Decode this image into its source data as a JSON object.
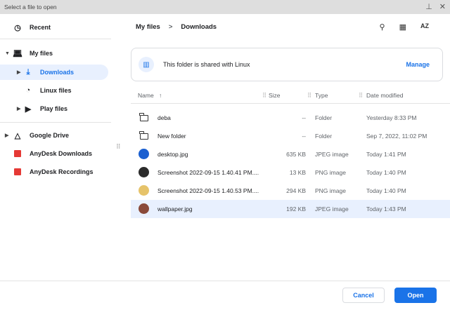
{
  "window": {
    "title": "Select a file to open",
    "pin_icon": "pin-icon",
    "close_icon": "close-icon"
  },
  "sidebar": {
    "items": [
      {
        "label": "Recent",
        "icon": "clock-icon"
      },
      {
        "label": "My files",
        "icon": "laptop-icon"
      },
      {
        "label": "Downloads",
        "icon": "download-icon"
      },
      {
        "label": "Linux files",
        "icon": "penguin-icon"
      },
      {
        "label": "Play files",
        "icon": "play-icon"
      },
      {
        "label": "Google Drive",
        "icon": "drive-icon"
      },
      {
        "label": "AnyDesk Downloads",
        "icon": "anydesk-icon"
      },
      {
        "label": "AnyDesk Recordings",
        "icon": "anydesk-icon"
      }
    ]
  },
  "breadcrumb": {
    "parent": "My files",
    "separator": ">",
    "current": "Downloads"
  },
  "toolbar": {
    "search": "search-icon",
    "grid": "grid-view-icon",
    "sort": "sort-az-icon",
    "sort_text": "AZ"
  },
  "banner": {
    "text": "This folder is shared with Linux",
    "manage": "Manage"
  },
  "columns": {
    "name": "Name",
    "sort_arrow": "↑",
    "size": "Size",
    "type": "Type",
    "date": "Date modified"
  },
  "files": [
    {
      "name": "deba",
      "size": "--",
      "type": "Folder",
      "date": "Yesterday 8:33 PM",
      "kind": "folder"
    },
    {
      "name": "New folder",
      "size": "--",
      "type": "Folder",
      "date": "Sep 7, 2022, 11:02 PM",
      "kind": "folder"
    },
    {
      "name": "desktop.jpg",
      "size": "635 KB",
      "type": "JPEG image",
      "date": "Today 1:41 PM",
      "kind": "image",
      "thumb": "#1a5fd0"
    },
    {
      "name": "Screenshot 2022-09-15 1.40.41 PM....",
      "size": "13 KB",
      "type": "PNG image",
      "date": "Today 1:40 PM",
      "kind": "image",
      "thumb": "#2b2b2b"
    },
    {
      "name": "Screenshot 2022-09-15 1.40.53 PM....",
      "size": "294 KB",
      "type": "PNG image",
      "date": "Today 1:40 PM",
      "kind": "image",
      "thumb": "#e6c36a"
    },
    {
      "name": "wallpaper.jpg",
      "size": "192 KB",
      "type": "JPEG image",
      "date": "Today 1:43 PM",
      "kind": "image",
      "thumb": "#8a4a3a",
      "selected": true
    }
  ],
  "footer": {
    "cancel": "Cancel",
    "open": "Open"
  }
}
